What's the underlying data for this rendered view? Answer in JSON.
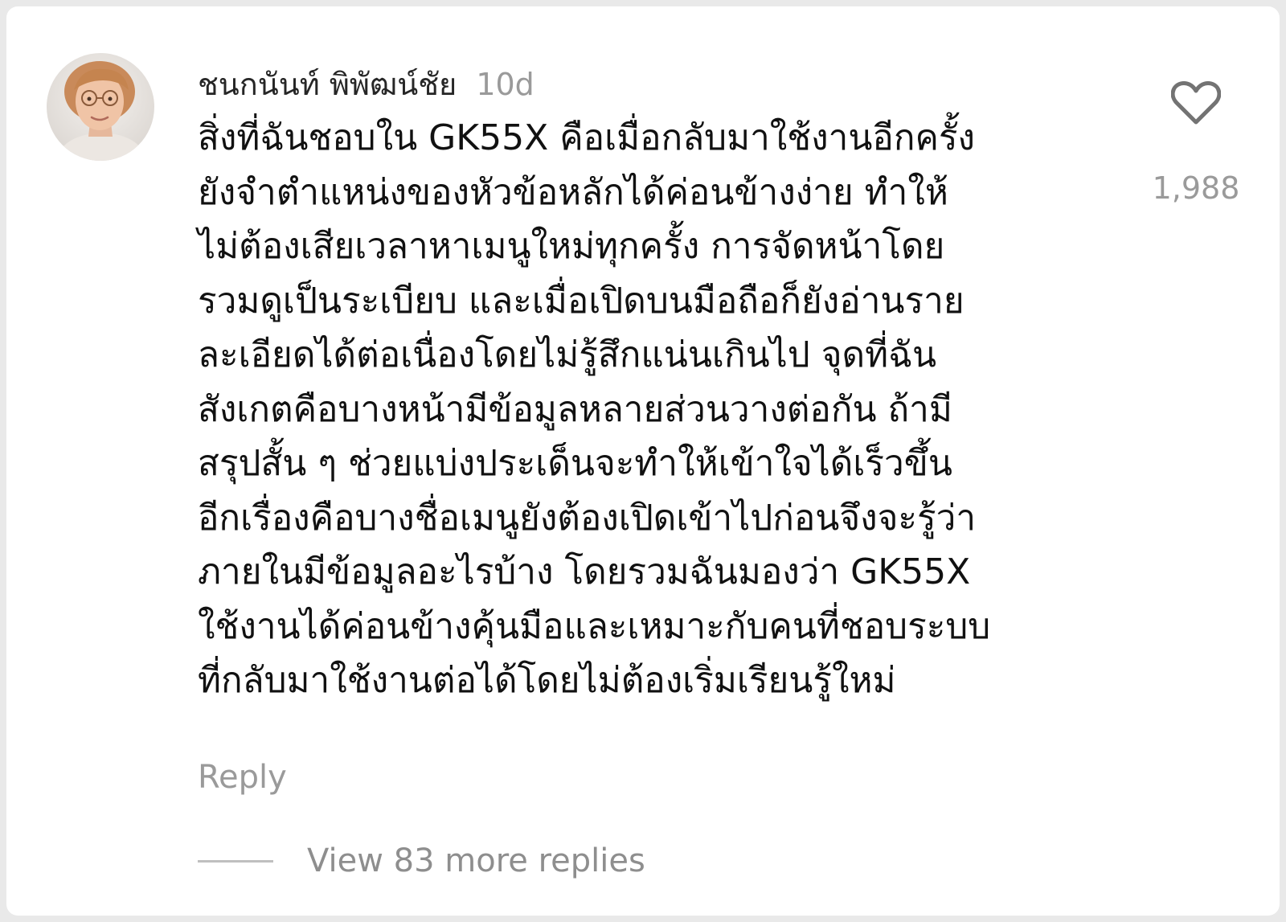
{
  "comment": {
    "username": "ชนกนันท์ พิพัฒน์ชัย",
    "timestamp": "10d",
    "text": "สิ่งที่ฉันชอบใน GK55X คือเมื่อกลับมาใช้งานอีกครั้ง\nยังจำตำแหน่งของหัวข้อหลักได้ค่อนข้างง่าย ทำให้\nไม่ต้องเสียเวลาหาเมนูใหม่ทุกครั้ง การจัดหน้าโดย\nรวมดูเป็นระเบียบ และเมื่อเปิดบนมือถือก็ยังอ่านราย\nละเอียดได้ต่อเนื่องโดยไม่รู้สึกแน่นเกินไป จุดที่ฉัน\nสังเกตคือบางหน้ามีข้อมูลหลายส่วนวางต่อกัน ถ้ามี\nสรุปสั้น ๆ ช่วยแบ่งประเด็นจะทำให้เข้าใจได้เร็วขึ้น\nอีกเรื่องคือบางชื่อเมนูยังต้องเปิดเข้าไปก่อนจึงจะรู้ว่า\nภายในมีข้อมูลอะไรบ้าง โดยรวมฉันมองว่า GK55X\nใช้งานได้ค่อนข้างคุ้นมือและเหมาะกับคนที่ชอบระบบ\nที่กลับมาใช้งานต่อได้โดยไม่ต้องเริ่มเรียนรู้ใหม่",
    "reply_label": "Reply",
    "view_replies_label": "View 83 more replies",
    "like_count": "1,988",
    "like_icon": "heart-outline-icon",
    "avatar_icon": "user-avatar"
  }
}
